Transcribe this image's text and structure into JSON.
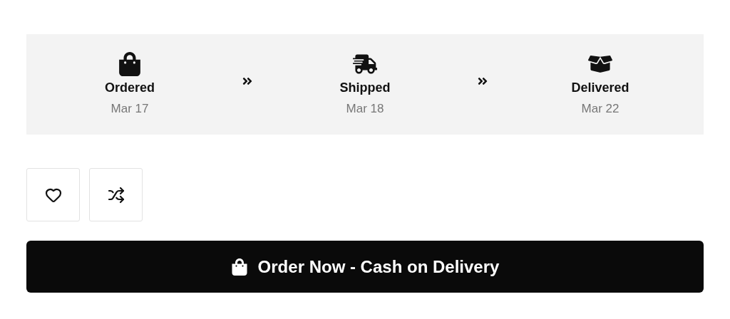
{
  "steps": [
    {
      "kind": "ordered",
      "label": "Ordered",
      "date": "Mar 17"
    },
    {
      "kind": "shipped",
      "label": "Shipped",
      "date": "Mar 18"
    },
    {
      "kind": "delivered",
      "label": "Delivered",
      "date": "Mar 22"
    }
  ],
  "actions": [
    {
      "kind": "wishlist"
    },
    {
      "kind": "compare"
    }
  ],
  "order_button": {
    "label": "Order Now - Cash on Delivery"
  }
}
